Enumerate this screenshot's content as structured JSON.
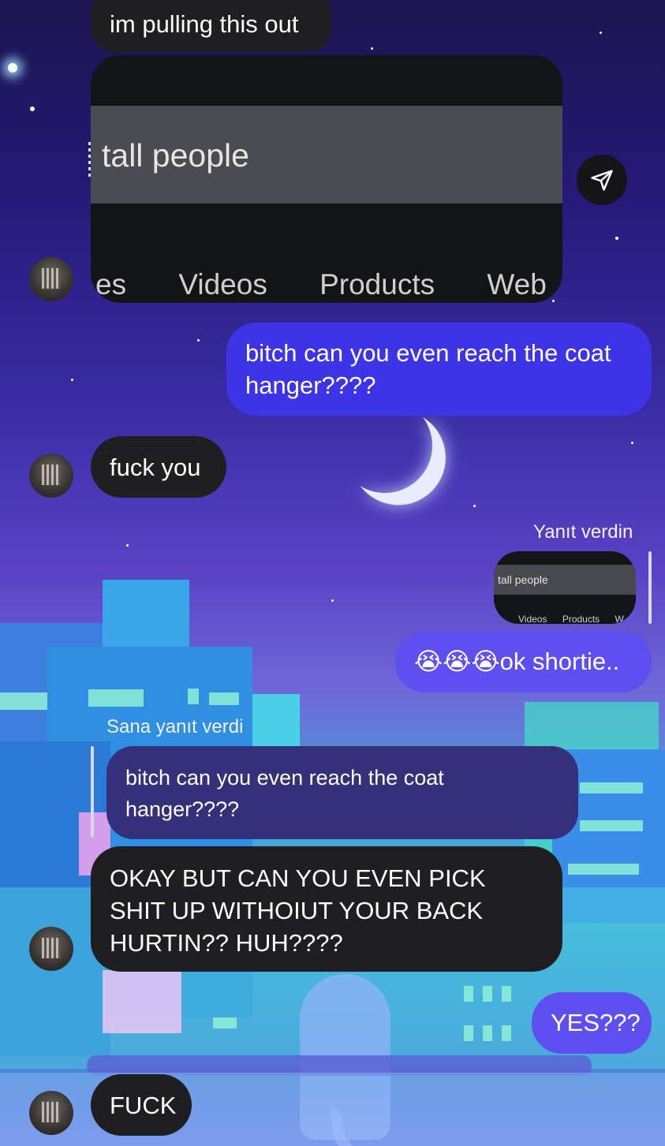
{
  "messages": {
    "m1": "im pulling this out",
    "image_search_text": "tall people",
    "image_tabs": [
      "es",
      "Videos",
      "Products",
      "Web"
    ],
    "m2": "bitch can you even reach the coat hanger????",
    "m3": "fuck you",
    "reply_label_sent": "Yanıt verdin",
    "thumb_search_text": "tall people",
    "thumb_tabs": [
      "Videos",
      "Products",
      "W"
    ],
    "m4": "😭😭😭ok shortie..",
    "reply_label_received": "Sana yanıt verdi",
    "quoted": "bitch can you even reach the coat hanger????",
    "m5": "OKAY BUT CAN YOU EVEN PICK SHIT UP WITHOIUT YOUR BACK HURTIN?? HUH????",
    "m6": "YES???",
    "m7": "FUCK"
  },
  "icons": {
    "share": "paper-plane-icon",
    "avatar": "contact-avatar"
  },
  "colors": {
    "sent_bubble": "#3d34e8",
    "received_bubble": "#1f1f22",
    "quoted_bubble": "#35307a"
  }
}
